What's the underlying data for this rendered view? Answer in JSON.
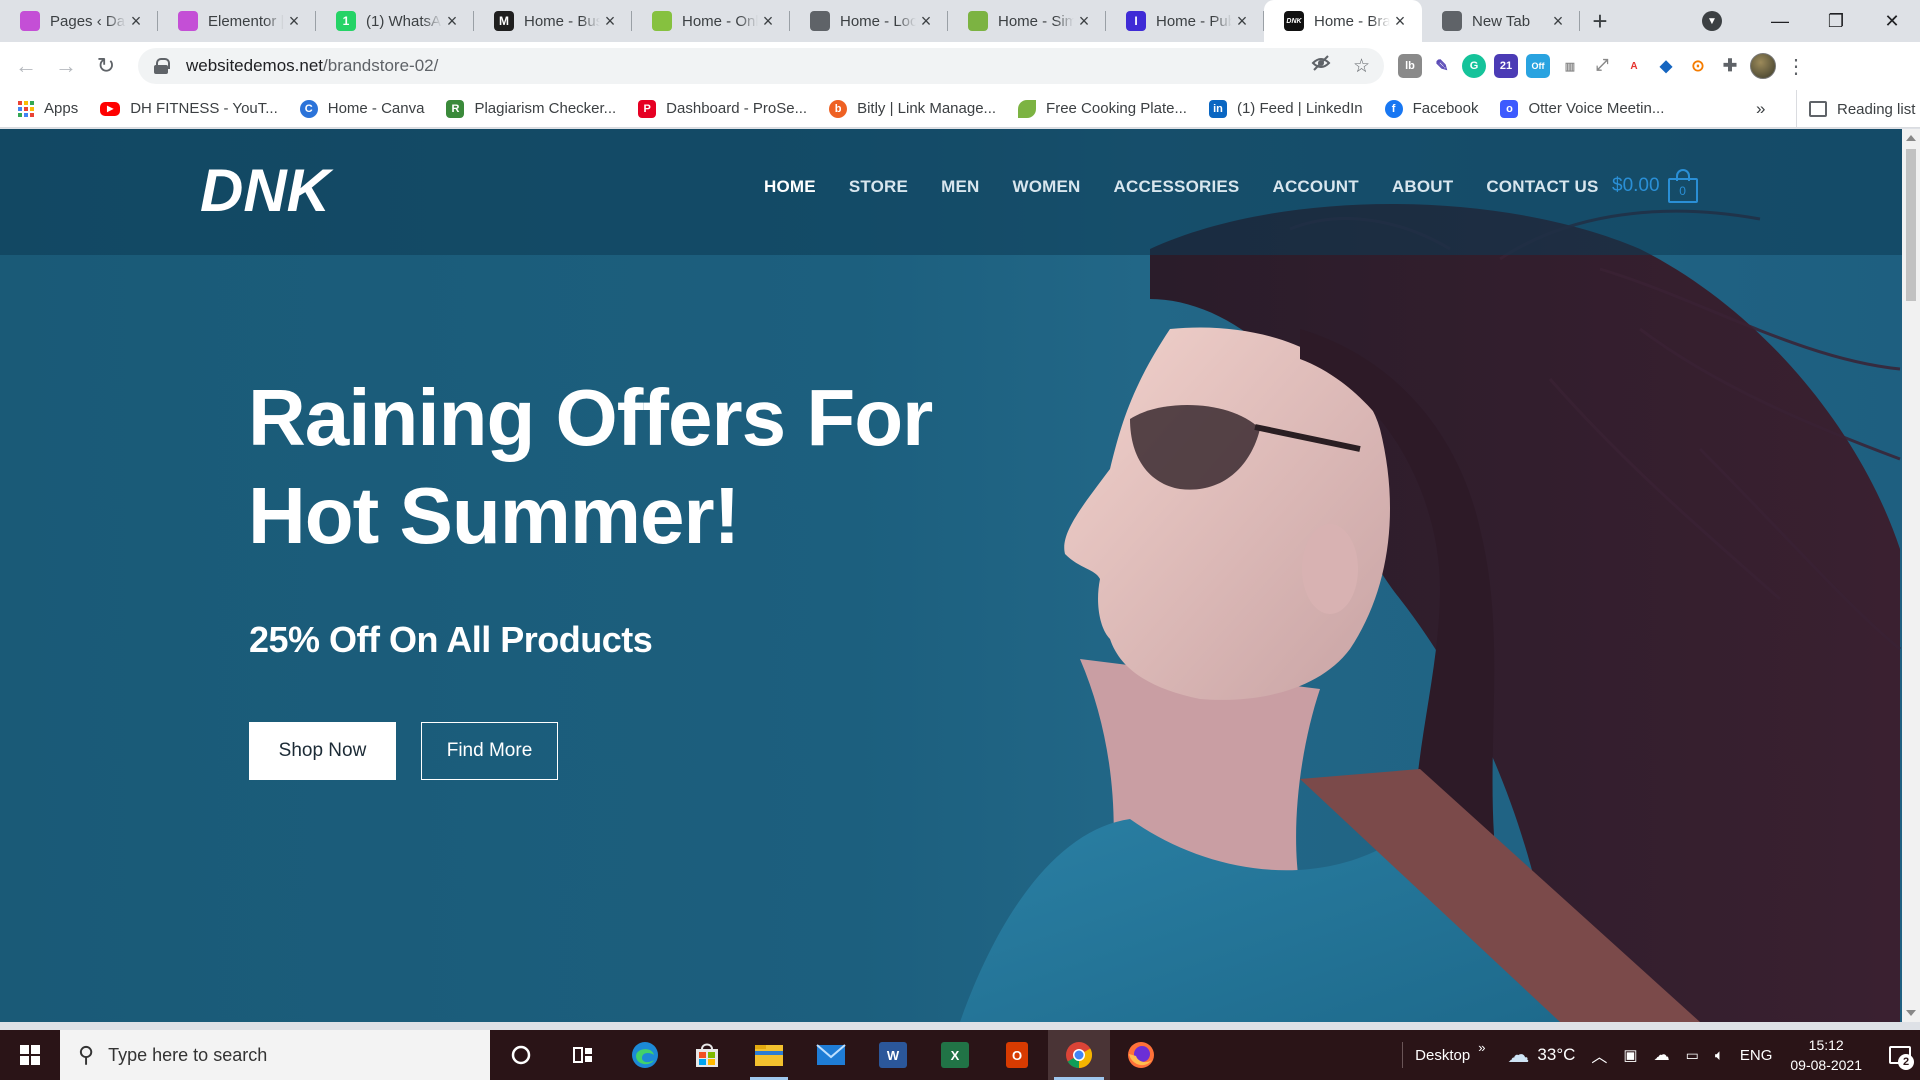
{
  "browser": {
    "tabs": [
      {
        "title": "Pages ‹ Dau",
        "favicon_color": "#c44fd6",
        "active": false
      },
      {
        "title": "Elementor |",
        "favicon_color": "#c44fd6",
        "active": false
      },
      {
        "title": "(1) WhatsAp",
        "favicon_color": "#25d366",
        "favicon_text": "1",
        "active": false
      },
      {
        "title": "Home - Bus",
        "favicon_color": "#1f1f1f",
        "favicon_text": "M",
        "active": false
      },
      {
        "title": "Home - Onl",
        "favicon_color": "#86c13f",
        "active": false
      },
      {
        "title": "Home - Loc",
        "favicon_color": "#5f6368",
        "active": false
      },
      {
        "title": "Home - Sim",
        "favicon_color": "#7cb342",
        "active": false
      },
      {
        "title": "Home - Pub",
        "favicon_color": "#3f2bd6",
        "favicon_text": "I",
        "active": false
      },
      {
        "title": "Home - Bra",
        "favicon_color": "#111111",
        "favicon_text": "DNK",
        "active": true
      },
      {
        "title": "New Tab",
        "favicon_color": "#5f6368",
        "active": false
      }
    ],
    "url_host": "websitedemos.net",
    "url_path": "/brandstore-02/",
    "bookmarks": [
      {
        "label": "Apps",
        "icon": "apps-grid-icon"
      },
      {
        "label": "DH FITNESS - YouT...",
        "icon": "youtube-icon",
        "color": "#ff0000"
      },
      {
        "label": "Home - Canva",
        "icon": "canva-icon",
        "color": "#2b73d9",
        "text": "C"
      },
      {
        "label": "Plagiarism Checker...",
        "icon": "plagiarism-icon",
        "color": "#3a8a3a",
        "text": "R"
      },
      {
        "label": "Dashboard - ProSe...",
        "icon": "pinterest-icon",
        "color": "#e60023",
        "text": "P"
      },
      {
        "label": "Bitly | Link Manage...",
        "icon": "bitly-icon",
        "color": "#ee6123",
        "text": "b"
      },
      {
        "label": "Free Cooking Plate...",
        "icon": "leaf-icon",
        "color": "#7cb342"
      },
      {
        "label": "(1) Feed | LinkedIn",
        "icon": "linkedin-icon",
        "color": "#0a66c2",
        "text": "in"
      },
      {
        "label": "Facebook",
        "icon": "facebook-icon",
        "color": "#1877f2",
        "text": "f"
      },
      {
        "label": "Otter Voice Meetin...",
        "icon": "otter-icon",
        "color": "#3d5afe",
        "text": "o"
      }
    ],
    "bookmarks_more": "»",
    "reading_list": "Reading list"
  },
  "site": {
    "logo_text": "DNK",
    "nav": [
      "HOME",
      "STORE",
      "MEN",
      "WOMEN",
      "ACCESSORIES",
      "ACCOUNT",
      "ABOUT",
      "CONTACT US"
    ],
    "cart_amount": "$0.00",
    "cart_count": "0",
    "headline_line1": "Raining Offers For",
    "headline_line2": "Hot Summer!",
    "subheadline": "25% Off On All Products",
    "btn_shop": "Shop Now",
    "btn_find": "Find More",
    "colors": {
      "hero_bg": "#1c5f7e",
      "cart_accent": "#2a8fd6"
    }
  },
  "taskbar": {
    "search_placeholder": "Type here to search",
    "desktop_label": "Desktop",
    "desktop_chevron": "»",
    "weather": "33°C",
    "lang": "ENG",
    "time": "15:12",
    "date": "09-08-2021",
    "notification_count": "2"
  }
}
